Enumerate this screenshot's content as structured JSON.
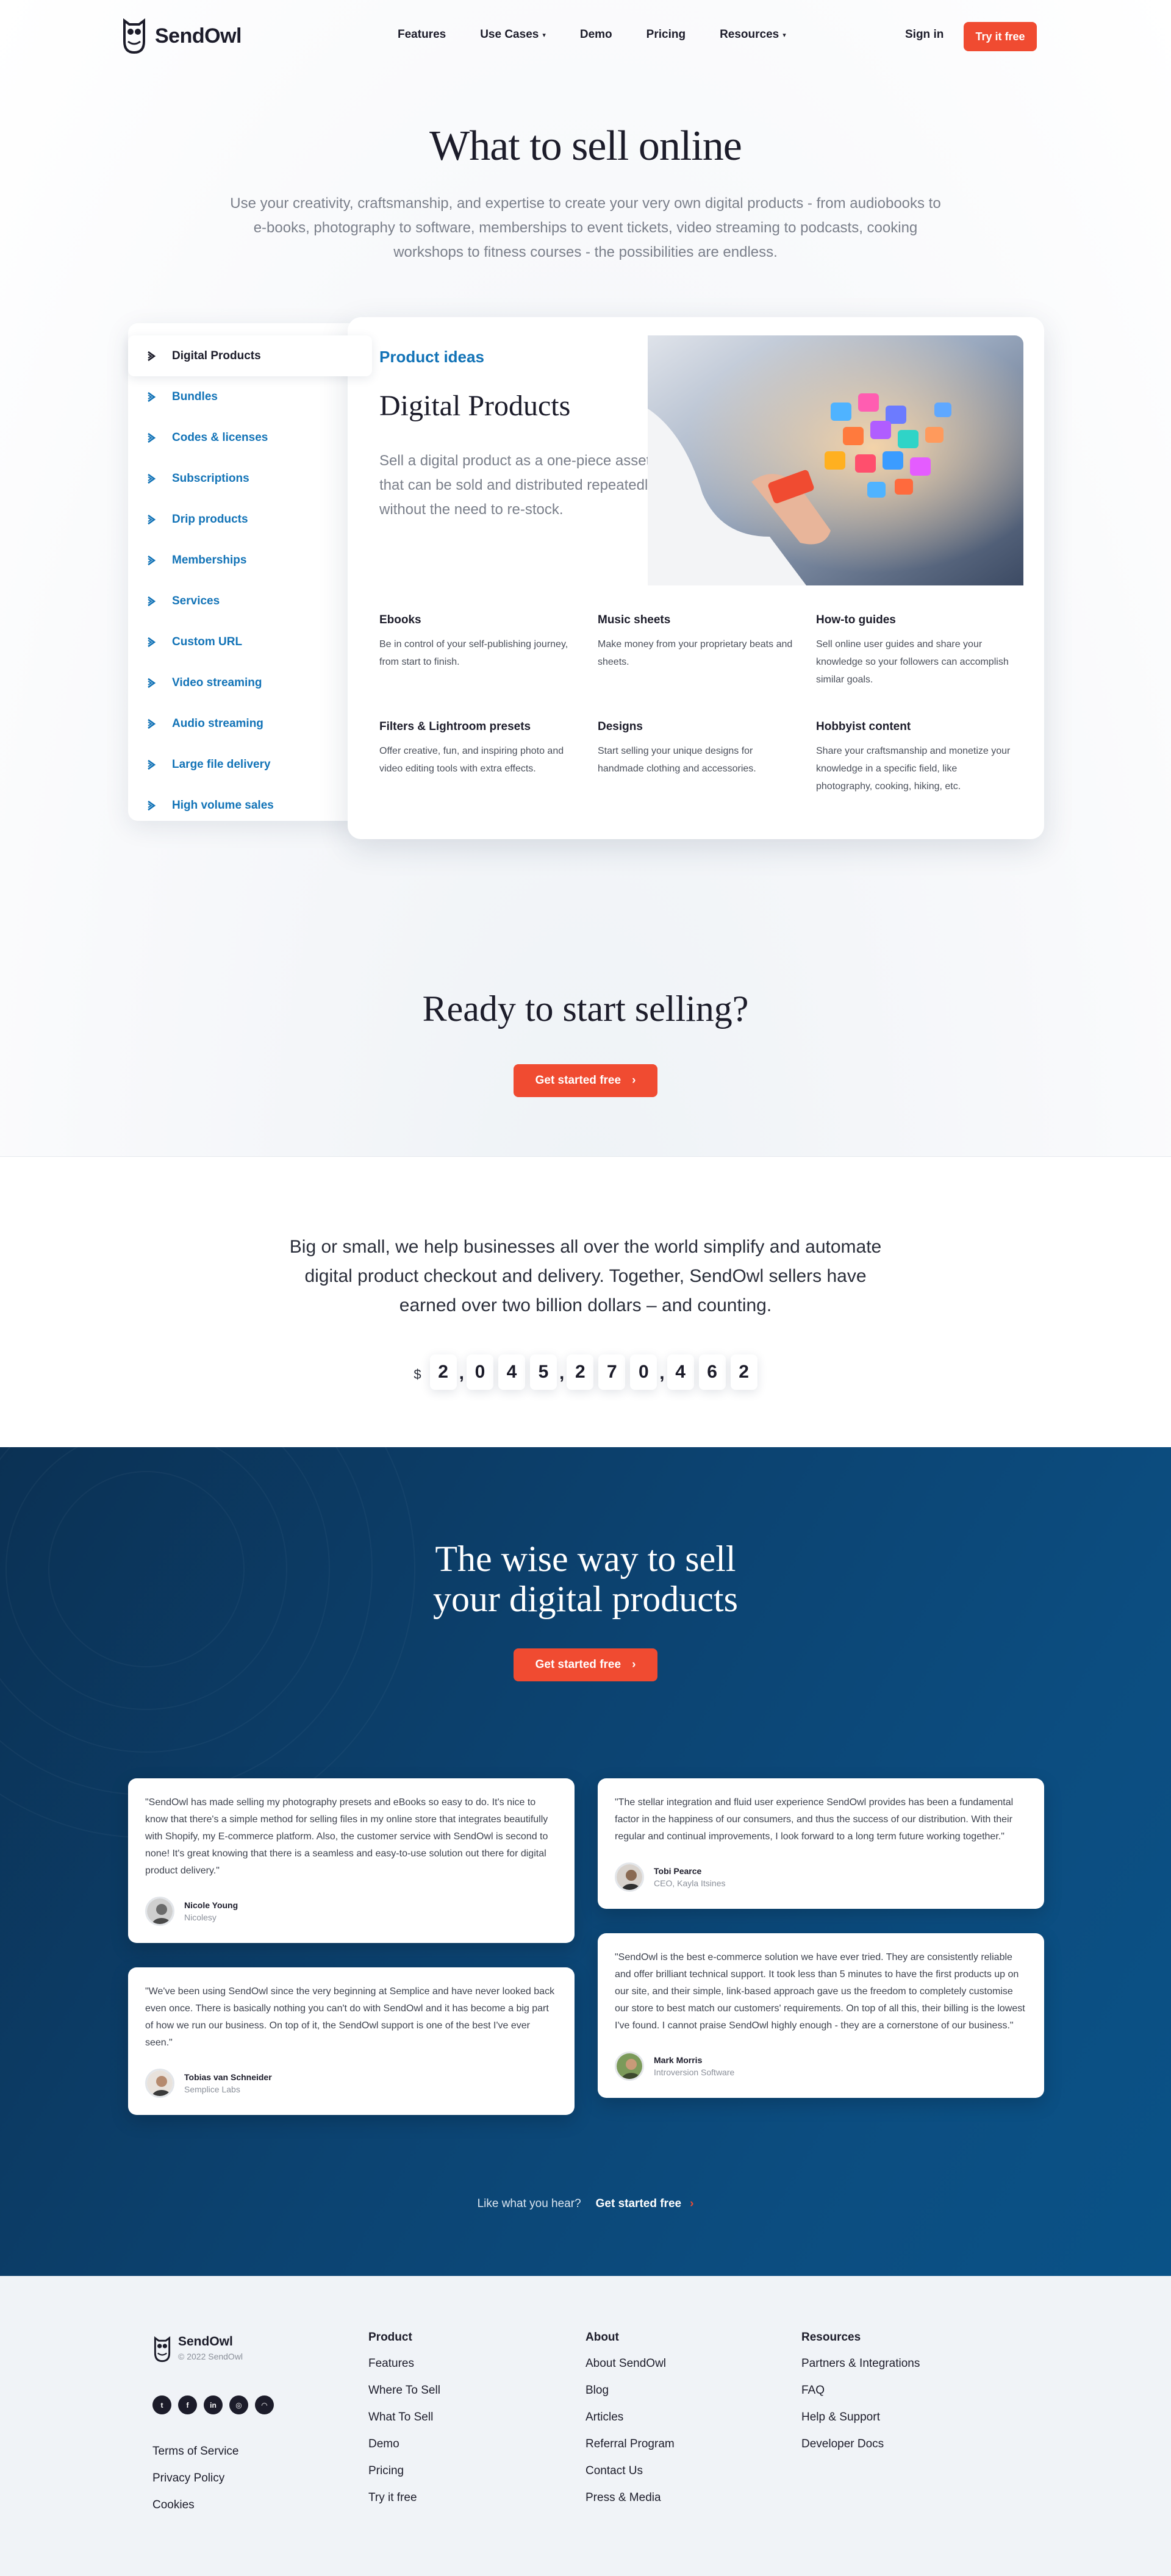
{
  "header": {
    "logo_text": "SendOwl",
    "nav": [
      {
        "label": "Features",
        "has_caret": false
      },
      {
        "label": "Use Cases",
        "has_caret": true
      },
      {
        "label": "Demo",
        "has_caret": false
      },
      {
        "label": "Pricing",
        "has_caret": false
      },
      {
        "label": "Resources",
        "has_caret": true
      }
    ],
    "signin_label": "Sign in",
    "try_label": "Try it free"
  },
  "hero": {
    "title": "What to sell online",
    "subtitle": "Use your creativity, craftsmanship, and expertise to create your very own digital products - from audiobooks to e-books, photography to software, memberships to event tickets, video streaming to podcasts, cooking workshops to fitness courses - the possibilities are endless."
  },
  "sidebar": {
    "items": [
      {
        "label": "Digital Products",
        "active": true
      },
      {
        "label": "Bundles"
      },
      {
        "label": "Codes & licenses"
      },
      {
        "label": "Subscriptions"
      },
      {
        "label": "Drip products"
      },
      {
        "label": "Memberships"
      },
      {
        "label": "Services"
      },
      {
        "label": "Custom URL"
      },
      {
        "label": "Video streaming"
      },
      {
        "label": "Audio streaming"
      },
      {
        "label": "Large file delivery"
      },
      {
        "label": "High volume sales"
      }
    ]
  },
  "panel": {
    "kicker": "Product ideas",
    "title": "Digital Products",
    "lead": "Sell a digital product as a one-piece asset that can be sold and distributed repeatedly without the need to re-stock.",
    "features": [
      {
        "title": "Ebooks",
        "text": "Be in control of your self-publishing journey, from start to finish."
      },
      {
        "title": "Music sheets",
        "text": "Make money from your proprietary beats and sheets."
      },
      {
        "title": "How-to guides",
        "text": "Sell online user guides and share your knowledge so your followers can accomplish similar goals."
      },
      {
        "title": "Filters & Lightroom presets",
        "text": "Offer creative, fun, and inspiring photo and video editing tools with extra effects."
      },
      {
        "title": "Designs",
        "text": "Start selling your unique designs for handmade clothing and accessories."
      },
      {
        "title": "Hobbyist content",
        "text": "Share your craftsmanship and monetize your knowledge in a specific field, like photography, cooking, hiking, etc."
      }
    ]
  },
  "ready": {
    "title": "Ready to start selling?",
    "cta_label": "Get started free"
  },
  "counter": {
    "text": "Big or small, we help businesses all over the world simplify and automate digital product checkout and delivery. Together, SendOwl sellers have earned over two billion dollars – and counting.",
    "currency": "$",
    "groups": [
      "2",
      "045",
      "270",
      "462"
    ]
  },
  "wise": {
    "title_line1": "The wise way to sell",
    "title_line2": "your digital products",
    "cta_label": "Get started free",
    "testimonials_left": [
      {
        "quote": "\"SendOwl has made selling my photography presets and eBooks so easy to do. It's nice to know that there's a simple method for selling files in my online store that integrates beautifully with Shopify, my E-commerce platform. Also, the customer service with SendOwl is second to none! It's great knowing that there is a seamless and easy-to-use solution out there for digital product delivery.\"",
        "name": "Nicole Young",
        "role": "Nicolesy"
      },
      {
        "quote": "\"We've been using SendOwl since the very beginning at Semplice and have never looked back even once. There is basically nothing you can't do with SendOwl and it has become a big part of how we run our business. On top of it, the SendOwl support is one of the best I've ever seen.\"",
        "name": "Tobias van Schneider",
        "role": "Semplice Labs"
      }
    ],
    "testimonials_right": [
      {
        "quote": "\"The stellar integration and fluid user experience SendOwl provides has been a fundamental factor in the happiness of our consumers, and thus the success of our distribution. With their regular and continual improvements, I look forward to a long term future working together.\"",
        "name": "Tobi Pearce",
        "role": "CEO, Kayla Itsines"
      },
      {
        "quote": "\"SendOwl is the best e-commerce solution we have ever tried. They are consistently reliable and offer brilliant technical support. It took less than 5 minutes to have the first products up on our site, and their simple, link-based approach gave us the freedom to completely customise our store to best match our customers' requirements. On top of all this, their billing is the lowest I've found. I cannot praise SendOwl highly enough - they are a cornerstone of our business.\"",
        "name": "Mark Morris",
        "role": "Introversion Software"
      }
    ],
    "like_text": "Like what you hear?",
    "like_cta": "Get started free"
  },
  "footer": {
    "logo_text": "SendOwl",
    "copyright": "© 2022 SendOwl",
    "social": [
      {
        "icon": "twitter-icon",
        "glyph": "t"
      },
      {
        "icon": "facebook-icon",
        "glyph": "f"
      },
      {
        "icon": "linkedin-icon",
        "glyph": "in"
      },
      {
        "icon": "instagram-icon",
        "glyph": "◎"
      },
      {
        "icon": "rss-icon",
        "glyph": "◠"
      }
    ],
    "legal": [
      "Terms of Service",
      "Privacy Policy",
      "Cookies"
    ],
    "columns": [
      {
        "title": "Product",
        "links": [
          "Features",
          "Where To Sell",
          "What To Sell",
          "Demo",
          "Pricing",
          "Try it free"
        ]
      },
      {
        "title": "About",
        "links": [
          "About SendOwl",
          "Blog",
          "Articles",
          "Referral Program",
          "Contact Us",
          "Press & Media"
        ]
      },
      {
        "title": "Resources",
        "links": [
          "Partners & Integrations",
          "FAQ",
          "Help & Support",
          "Developer Docs"
        ]
      }
    ]
  },
  "colors": {
    "accent": "#f04b31",
    "link_blue": "#1273b7",
    "navy": "#0c4371",
    "text": "#1c1c2a"
  }
}
